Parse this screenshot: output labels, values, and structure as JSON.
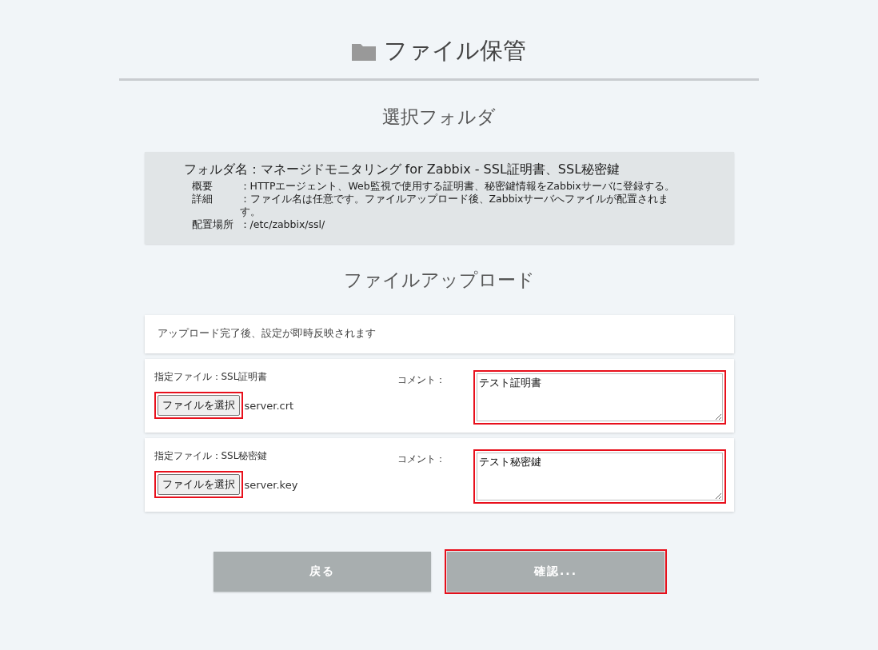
{
  "page_title": "ファイル保管",
  "folder_section": {
    "heading": "選択フォルダ",
    "folder_name": "フォルダ名：マネージドモニタリング for Zabbix - SSL証明書、SSL秘密鍵",
    "details": [
      {
        "label": "概要",
        "value": "：HTTPエージェント、Web監視で使用する証明書、秘密鍵情報をZabbixサーバに登録する。"
      },
      {
        "label": "詳細",
        "value": "：ファイル名は任意です。ファイルアップロード後、Zabbixサーバへファイルが配置されます。"
      },
      {
        "label": "配置場所",
        "value": "：/etc/zabbix/ssl/"
      }
    ]
  },
  "upload_section": {
    "heading": "ファイルアップロード",
    "notice": "アップロード完了後、設定が即時反映されます",
    "files": [
      {
        "label": "指定ファイル：SSL証明書",
        "button": "ファイルを選択",
        "file_name": "server.crt",
        "comment_label": "コメント：",
        "comment": "テスト証明書",
        "button_highlighted": true,
        "comment_highlighted": true
      },
      {
        "label": "指定ファイル：SSL秘密鍵",
        "button": "ファイルを選択",
        "file_name": "server.key",
        "comment_label": "コメント：",
        "comment": "テスト秘密鍵",
        "button_highlighted": true,
        "comment_highlighted": true
      }
    ]
  },
  "buttons": [
    {
      "label": "戻る",
      "highlighted": false
    },
    {
      "label": "確認...",
      "highlighted": true
    }
  ]
}
